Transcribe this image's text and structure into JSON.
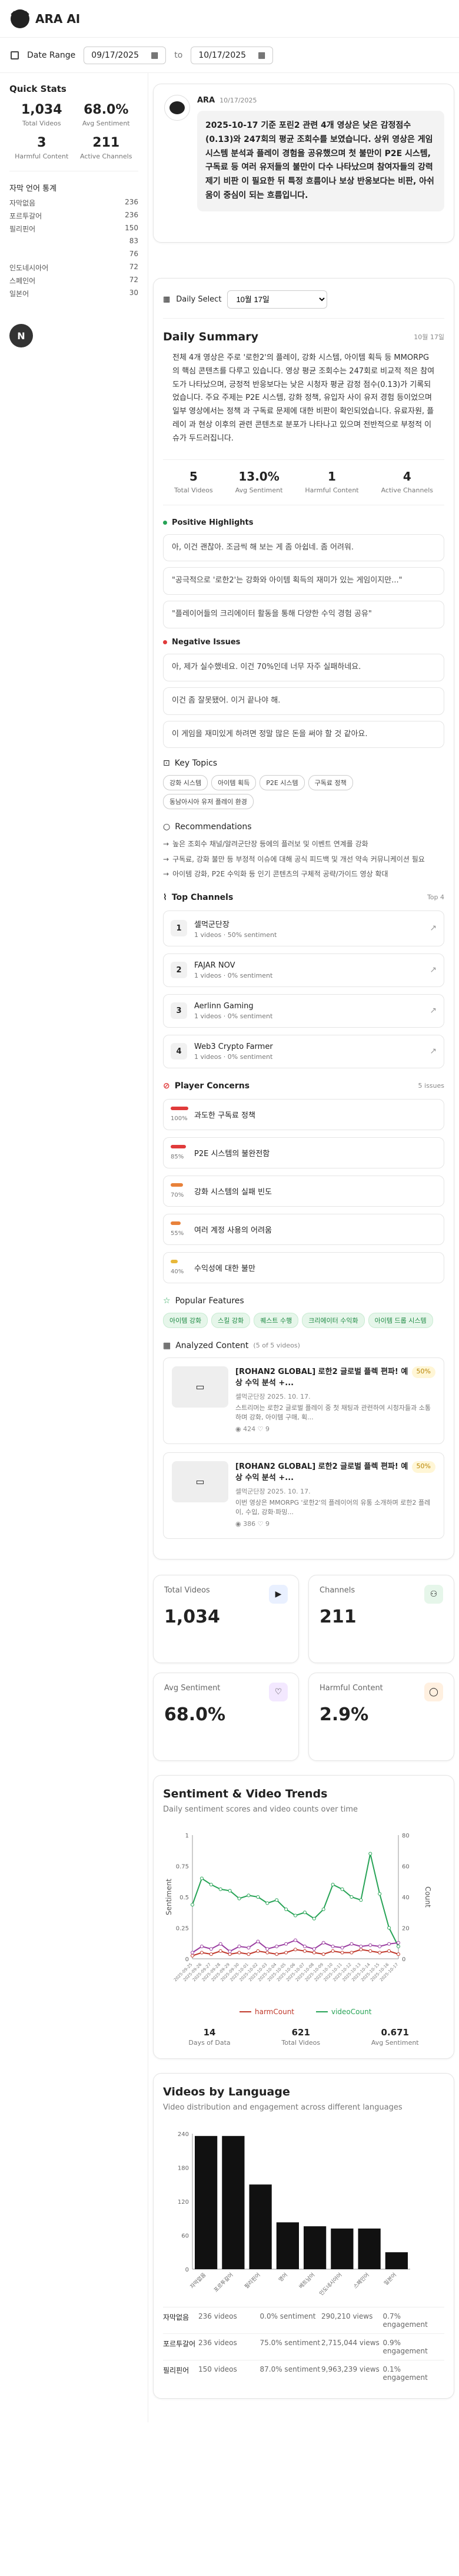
{
  "app": {
    "title": "ARA AI"
  },
  "filters": {
    "label": "Date Range",
    "start": "09/17/2025",
    "to": "to",
    "end": "10/17/2025"
  },
  "sidebar": {
    "title": "Quick Stats",
    "stats": [
      {
        "value": "1,034",
        "label": "Total Videos"
      },
      {
        "value": "68.0%",
        "label": "Avg Sentiment"
      },
      {
        "value": "3",
        "label": "Harmful Content"
      },
      {
        "value": "211",
        "label": "Active Channels"
      }
    ],
    "lang_title": "자막 언어 통계",
    "languages": [
      {
        "name": "자막없음",
        "count": "236"
      },
      {
        "name": "포르투갈어",
        "count": "236"
      },
      {
        "name": "필리핀어",
        "count": "150"
      },
      {
        "name": "",
        "count": "83"
      },
      {
        "name": "",
        "count": "76"
      },
      {
        "name": "인도네시아어",
        "count": "72"
      },
      {
        "name": "스페인어",
        "count": "72"
      },
      {
        "name": "일본어",
        "count": "30"
      }
    ],
    "avatar": "N"
  },
  "message": {
    "sender": "ARA",
    "date": "10/17/2025",
    "text": "2025-10-17 기준 포린2 관련 4개 영상은 낮은 감정점수(0.13)와 247회의 평균 조회수를 보였습니다. 상위 영상은 게임 시스템 분석과 플레이 경험을 공유했으며 첫 불만이 P2E 시스템, 구독료 등 여러 유저들의 불만이 다수 나타났으며 참여자들의 강력 제기 비판 이 필요한 뒤 특정 흐름이나 보상 반응보다는 비판, 아쉬움이 중심이 되는 흐름입니다."
  },
  "daily": {
    "select_label": "Daily Select",
    "select_value": "10월 17일",
    "title": "Daily Summary",
    "date": "10월 17일",
    "summary": "전체 4개 영상은 주로 '로한2'의 플레이, 강화 시스템, 아이템 획득 등 MMORPG의 핵심 콘텐츠를 다루고 있습니다. 영상 평균 조회수는 247회로 비교적 적은 참여도가 나타났으며, 긍정적 반응보다는 낮은 시청자 평균 감정 점수(0.13)가 기록되었습니다. 주요 주제는 P2E 시스템, 강화 정책, 유입자 사이 유저 경험 등이었으며 일부 영상에서는 정책 과 구독료 문제에 대한 비판이 확인되었습니다. 유료자원, 플레이 과 현상 이후의 관련 콘텐츠로 분포가 나타나고 있으며 전반적으로 부정적 이슈가 두드러집니다.",
    "kpis": [
      {
        "value": "5",
        "label": "Total Videos"
      },
      {
        "value": "13.0%",
        "label": "Avg Sentiment"
      },
      {
        "value": "1",
        "label": "Harmful Content"
      },
      {
        "value": "4",
        "label": "Active Channels"
      }
    ],
    "positive_title": "Positive Highlights",
    "positives": [
      "아, 이건 괜찮아. 조금씩 해 보는 게 좀 아쉽네. 좀 어려워.",
      "\"공극적으로 '로한2'는 강화와 아이템 획득의 재미가 있는 게임이지만...\"",
      "\"플레이어들의 크리에이터 활동을 통해 다양한 수익 경험 공유\""
    ],
    "negative_title": "Negative Issues",
    "negatives": [
      "아, 제가 실수했네요. 이건 70%인데 너무 자주 실패하네요.",
      "이건 좀 잘못됐어. 이거 끝나야 해.",
      "이 게임을 재미있게 하려면 정말 많은 돈을 써야 할 것 같아요."
    ],
    "topics_title": "Key Topics",
    "topics": [
      "강화 시스템",
      "아이템 획득",
      "P2E 시스템",
      "구독료 정책",
      "동남아시아 유저 플레이 환경"
    ],
    "rec_title": "Recommendations",
    "recs": [
      "높은 조회수 채널/알려군단장 등에의 플러보 및 이벤트 연계를 강화",
      "구독료, 강화 불만 등 부정적 이슈에 대해 공식 피드백 및 개선 약속 커뮤니케이션 필요",
      "아이템 강화, P2E 수익화 등 인기 콘텐츠의 구체적 공략/가이드 영상 확대"
    ]
  },
  "top_channels": {
    "title": "Top Channels",
    "meta": "Top 4",
    "items": [
      {
        "rank": "1",
        "name": "셀먹군단장",
        "meta": "1 videos · 50% sentiment"
      },
      {
        "rank": "2",
        "name": "FAJAR NOV",
        "meta": "1 videos · 0% sentiment"
      },
      {
        "rank": "3",
        "name": "Aerlinn Gaming",
        "meta": "1 videos · 0% sentiment"
      },
      {
        "rank": "4",
        "name": "Web3 Crypto Farmer",
        "meta": "1 videos · 0% sentiment"
      }
    ]
  },
  "concerns": {
    "title": "Player Concerns",
    "meta": "5 issues",
    "items": [
      {
        "text": "과도한 구독료 정책",
        "pct": "100%",
        "level": 1.0,
        "color": "#e03a3a"
      },
      {
        "text": "P2E 시스템의 불완전함",
        "pct": "85%",
        "level": 0.85,
        "color": "#e03a3a"
      },
      {
        "text": "강화 시스템의 실패 빈도",
        "pct": "70%",
        "level": 0.7,
        "color": "#e8813a"
      },
      {
        "text": "여러 계정 사용의 어려움",
        "pct": "55%",
        "level": 0.55,
        "color": "#e8813a"
      },
      {
        "text": "수익성에 대한 불만",
        "pct": "40%",
        "level": 0.4,
        "color": "#e8b83a"
      }
    ]
  },
  "features": {
    "title": "Popular Features",
    "items": [
      "아이템 강화",
      "스킬 강화",
      "퀘스트 수행",
      "크리에이터 수익화",
      "아이템 드롭 시스템"
    ]
  },
  "analyzed": {
    "title": "Analyzed Content",
    "meta": "(5 of 5 videos)",
    "videos": [
      {
        "title": "[ROHAN2 GLOBAL] 로한2 글로벌 플렉 편파! 예상 수익 분석 +...",
        "pct": "50%",
        "channel": "셀먹군단장",
        "date": "2025. 10. 17.",
        "desc": "스트리머는 로한2 글로벌 플레이 중 첫 채팅과 관련하여 시청자들과 소통하며 강화, 아이템 구매, 획...",
        "views": "424",
        "likes": "9"
      },
      {
        "title": "[ROHAN2 GLOBAL] 로한2 글로벌 플렉 편파! 예상 수익 분석 +...",
        "pct": "50%",
        "channel": "셀먹군단장",
        "date": "2025. 10. 17.",
        "desc": "이번 영상은 MMORPG '로한2'의 플레이어의 유통 소개하며 로한2 플레이, 수입, 강화·파밍...",
        "views": "386",
        "likes": "9"
      }
    ]
  },
  "metrics": [
    {
      "label": "Total Videos",
      "value": "1,034",
      "icon": "video-icon",
      "color": "#e9f0ff"
    },
    {
      "label": "Channels",
      "value": "211",
      "icon": "users-icon",
      "color": "#e6f6ea"
    },
    {
      "label": "Avg Sentiment",
      "value": "68.0%",
      "icon": "heart-icon",
      "color": "#f3e8ff"
    },
    {
      "label": "Harmful Content",
      "value": "2.9%",
      "icon": "alert-icon",
      "color": "#fff0e0"
    }
  ],
  "trend": {
    "title": "Sentiment & Video Trends",
    "desc": "Daily sentiment scores and video counts over time",
    "summary": [
      {
        "value": "14",
        "label": "Days of Data"
      },
      {
        "value": "621",
        "label": "Total Videos"
      },
      {
        "value": "0.671",
        "label": "Avg Sentiment"
      }
    ]
  },
  "lang_chart": {
    "title": "Videos by Language",
    "desc": "Video distribution and engagement across different languages",
    "rows": [
      {
        "lang": "자막없음",
        "videos": "236 videos",
        "sent": "0.0% sentiment",
        "views": "290,210 views",
        "eng": "0.7% engagement"
      },
      {
        "lang": "포르투갈어",
        "videos": "236 videos",
        "sent": "75.0% sentiment",
        "views": "2,715,044 views",
        "eng": "0.9% engagement"
      },
      {
        "lang": "필리핀어",
        "videos": "150 videos",
        "sent": "87.0% sentiment",
        "views": "9,963,239 views",
        "eng": "0.1% engagement"
      }
    ]
  },
  "chart_data": [
    {
      "type": "line",
      "title": "Sentiment & Video Trends",
      "x": [
        "2025-09-25",
        "2025-09-26",
        "2025-09-27",
        "2025-09-28",
        "2025-09-29",
        "2025-09-30",
        "2025-10-01",
        "2025-10-02",
        "2025-10-03",
        "2025-10-04",
        "2025-10-05",
        "2025-10-06",
        "2025-10-07",
        "2025-10-08",
        "2025-10-09",
        "2025-10-10",
        "2025-10-11",
        "2025-10-12",
        "2025-10-13",
        "2025-10-14",
        "2025-10-15",
        "2025-10-16",
        "2025-10-17"
      ],
      "series": [
        {
          "name": "harmCount",
          "axis": "right",
          "color": "#c0392b",
          "values": [
            2,
            4,
            3,
            5,
            3,
            4,
            3,
            5,
            4,
            3,
            4,
            6,
            5,
            4,
            3,
            5,
            4,
            4,
            6,
            5,
            4,
            5,
            3
          ]
        },
        {
          "name": "videoCount",
          "axis": "right",
          "color": "#27a356",
          "values": [
            35,
            52,
            48,
            45,
            44,
            39,
            41,
            40,
            36,
            38,
            32,
            28,
            30,
            26,
            32,
            48,
            45,
            40,
            38,
            68,
            42,
            20,
            8
          ]
        },
        {
          "name": "sentiment",
          "axis": "left",
          "color": "#9a3da0",
          "values": [
            0.05,
            0.1,
            0.08,
            0.12,
            0.06,
            0.1,
            0.09,
            0.14,
            0.08,
            0.1,
            0.12,
            0.15,
            0.1,
            0.08,
            0.13,
            0.1,
            0.09,
            0.12,
            0.1,
            0.11,
            0.1,
            0.12,
            0.13
          ]
        }
      ],
      "ylabel": "Sentiment",
      "ylim": [
        0,
        1
      ],
      "y2label": "Count",
      "y2lim": [
        0,
        80
      ],
      "legend": [
        "harmCount",
        "videoCount"
      ]
    },
    {
      "type": "bar",
      "title": "Videos by Language",
      "categories": [
        "자막없음",
        "포르투갈어",
        "필리핀어",
        "영어",
        "베트남어",
        "인도네시아어",
        "스페인어",
        "일본어"
      ],
      "values": [
        236,
        236,
        150,
        83,
        76,
        72,
        72,
        30
      ],
      "ylim": [
        0,
        240
      ],
      "yticks": [
        0,
        60,
        120,
        180,
        240
      ]
    }
  ]
}
